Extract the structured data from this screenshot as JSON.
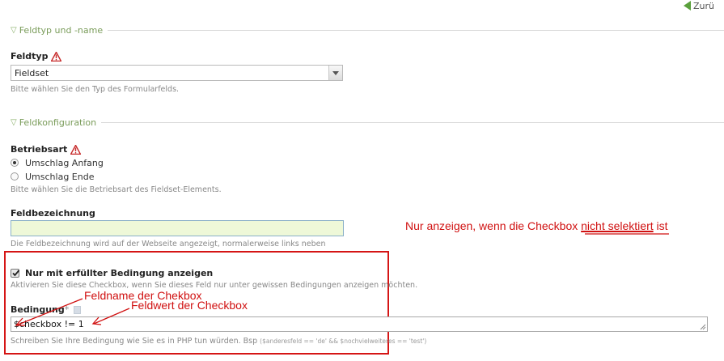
{
  "header": {
    "back_label": "Zurü"
  },
  "sections": {
    "fieldtype": {
      "title": "Feldtyp und -name"
    },
    "fieldconfig": {
      "title": "Feldkonfiguration"
    }
  },
  "feldtyp": {
    "label": "Feldtyp",
    "selected": "Fieldset",
    "help": "Bitte wählen Sie den Typ des Formularfelds."
  },
  "betriebsart": {
    "label": "Betriebsart",
    "options": [
      "Umschlag Anfang",
      "Umschlag Ende"
    ],
    "selected_index": 0,
    "help": "Bitte wählen Sie die Betriebsart des Fieldset-Elements."
  },
  "feldbezeichnung": {
    "label": "Feldbezeichnung",
    "value": "",
    "help": "Die Feldbezeichnung wird auf der Webseite angezeigt, normalerweise links neben"
  },
  "bedingung_toggle": {
    "checked": true,
    "label": "Nur mit erfüllter Bedingung anzeigen",
    "help": "Aktivieren Sie diese Checkbox, wenn Sie dieses Feld nur unter gewissen Bedingungen anzeigen möchten."
  },
  "bedingung": {
    "label": "Bedingung",
    "required_mark": "*",
    "value": "$checkbox != 1",
    "help": "Schreiben Sie Ihre Bedingung wie Sie es in PHP tun würden. Bsp",
    "example": "($anderesfeld == 'de' && $nochvielweiteres == 'test')"
  },
  "annotations": {
    "note_part1": "Nur anzeigen, wenn die Checkbox ",
    "note_part2": "nicht selektiert",
    "note_part3": " ist",
    "arrow_feldname": "Feldname der Chekbox",
    "arrow_feldwert": "Feldwert der Checkbox",
    "color": "#d01010"
  },
  "colors": {
    "section_title": "#7a9c5a",
    "input_highlight": "#eef8d8",
    "annotation_red": "#d51515"
  }
}
